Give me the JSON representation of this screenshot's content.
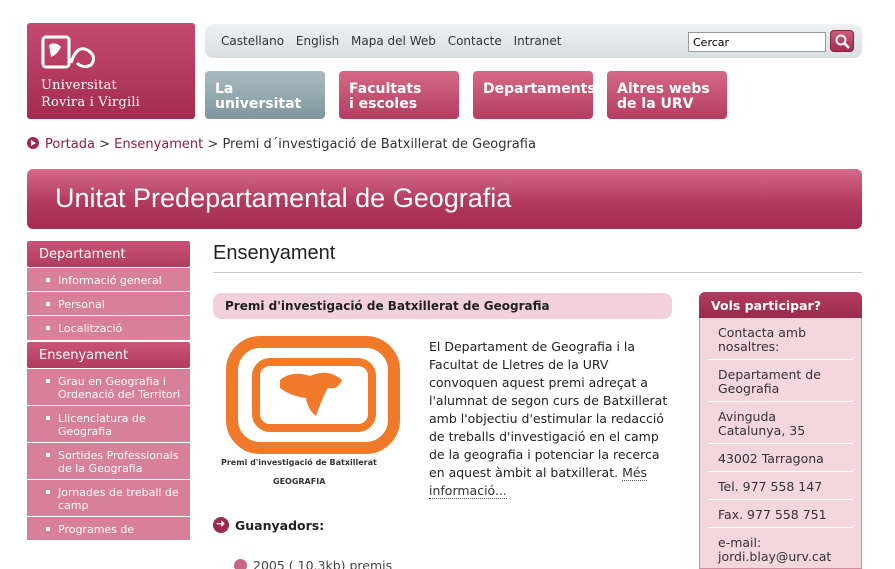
{
  "logo": {
    "line1": "Universitat",
    "line2": "Rovira i Virgili"
  },
  "topbar": {
    "links": [
      "Castellano",
      "English",
      "Mapa del Web",
      "Contacte",
      "Intranet"
    ],
    "search_value": "Cercar"
  },
  "nav": [
    {
      "line1": "La",
      "line2": "universitat"
    },
    {
      "line1": "Facultats",
      "line2": "i escoles"
    },
    {
      "line1": "Departaments",
      "line2": ""
    },
    {
      "line1": "Altres webs",
      "line2": "de la URV"
    }
  ],
  "breadcrumb": {
    "home": "Portada",
    "sep1": " > ",
    "section": "Ensenyament",
    "sep2": " > ",
    "current": "Premi d´investigació de Batxillerat de Geografia"
  },
  "banner": {
    "title": "Unitat Predepartamental de Geografia"
  },
  "sidebar": {
    "sections": [
      {
        "label": "Departament",
        "items": [
          "Informació general",
          "Personal",
          "Localització"
        ]
      },
      {
        "label": "Ensenyament",
        "items": [
          "Grau en Geografia i Ordenació del Territori",
          "Llicenciatura de Geografia",
          "Sortides Professionals de la Geografia",
          "Jornades de treball de camp",
          "Programes de"
        ]
      }
    ]
  },
  "main": {
    "title": "Ensenyament",
    "subtitle": "Premi d'investigació de Batxillerat de Geografia",
    "poster_caption1": "Premi d'investigació de Batxillerat",
    "poster_caption2": "GEOGRAFIA",
    "body": "El Departament de Geografia i la Facultat de Lletres de la URV convoquen aquest premi adreçat a l'alumnat de segon curs de Batxillerat amb l'objectiu d'estimular la redacció de treballs d'investigació en el camp de la geografia i potenciar la recerca en aquest àmbit al batxillerat.",
    "more": "Més informació...",
    "winners_label": "Guanyadors:",
    "download": "2005 ( 10.3kb) premis"
  },
  "rightbox": {
    "title": "Vols participar?",
    "rows": [
      "Contacta amb nosaltres:",
      "Departament de Geografia",
      "Avinguda Catalunya, 35",
      "43002 Tarragona",
      "Tel. 977 558 147",
      "Fax. 977 558 751",
      "e-mail: jordi.blay@urv.cat"
    ]
  },
  "colors": {
    "brand": "#a42b50",
    "brand_light": "#d87f99",
    "nav_gray": "#8fa5ac",
    "pink_bg": "#f3d1dc"
  }
}
